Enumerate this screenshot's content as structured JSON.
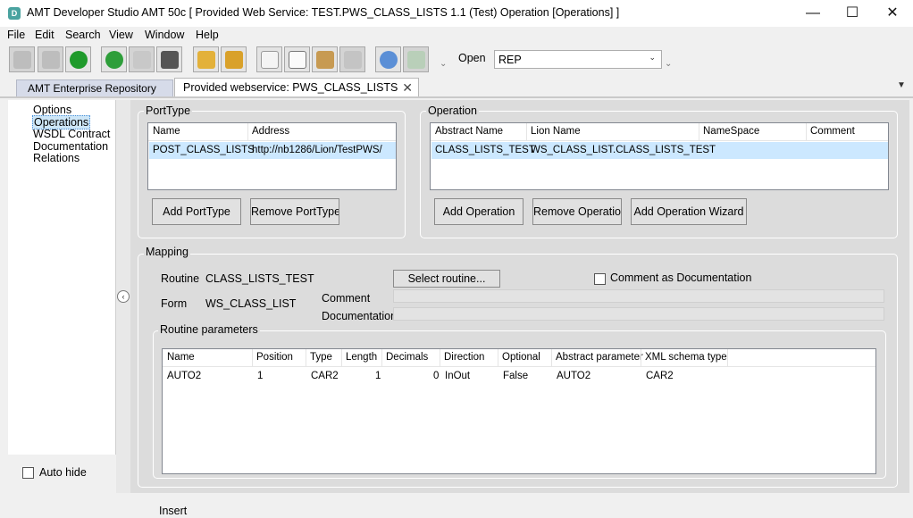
{
  "window": {
    "icon_letter": "D",
    "title": "AMT Developer Studio AMT 50c  [ Provided Web Service: TEST.PWS_CLASS_LISTS 1.1 (Test) Operation [Operations] ]",
    "minimize": "—",
    "maximize": "☐",
    "close": "✕"
  },
  "menu": [
    "File",
    "Edit",
    "Search",
    "View",
    "Window",
    "Help"
  ],
  "toolbar": {
    "open_label": "Open",
    "open_value": "REP",
    "chevron": "⌄",
    "overflow": "⌄"
  },
  "tabs": {
    "repo": "AMT Enterprise Repository",
    "active": "Provided webservice: PWS_CLASS_LISTS",
    "close": "✕",
    "menu_glyph": "▼"
  },
  "nav": {
    "items": [
      "Options",
      "Operations",
      "WSDL Contract",
      "Documentation",
      "Relations"
    ],
    "auto_hide": "Auto hide",
    "collapse": "‹"
  },
  "porttype": {
    "title": "PortType",
    "columns": [
      "Name",
      "Address"
    ],
    "rows": [
      {
        "name": "POST_CLASS_LISTS",
        "address": "http://nb1286/Lion/TestPWS/"
      }
    ],
    "add_button": "Add PortType",
    "remove_button": "Remove PortType"
  },
  "operation": {
    "title": "Operation",
    "columns": [
      "Abstract Name",
      "Lion Name",
      "NameSpace",
      "Comment"
    ],
    "rows": [
      {
        "abstract": "CLASS_LISTS_TEST",
        "lion": "WS_CLASS_LIST.CLASS_LISTS_TEST",
        "namespace": "",
        "comment": ""
      }
    ],
    "add_button": "Add Operation",
    "remove_button": "Remove Operation",
    "wizard_button": "Add Operation Wizard"
  },
  "mapping": {
    "title": "Mapping",
    "routine_label": "Routine",
    "routine_value": "CLASS_LISTS_TEST",
    "form_label": "Form",
    "form_value": "WS_CLASS_LIST",
    "select_button": "Select routine...",
    "comment_as_doc": "Comment as Documentation",
    "comment_label": "Comment",
    "documentation_label": "Documentation"
  },
  "params": {
    "title": "Routine parameters",
    "columns": [
      "Name",
      "Position",
      "Type",
      "Length",
      "Decimals",
      "Direction",
      "Optional",
      "Abstract parameter",
      "XML schema type"
    ],
    "rows": [
      {
        "name": "AUTO2",
        "position": "1",
        "type": "CAR2",
        "length": "1",
        "decimals": "0",
        "direction": "InOut",
        "optional": "False",
        "abstract": "AUTO2",
        "xml": "CAR2"
      }
    ]
  },
  "status": {
    "text": "Insert"
  },
  "colors": {
    "selection": "#cce8ff",
    "panel": "#dcdcdc",
    "tab_inactive": "#d6dbe9"
  }
}
